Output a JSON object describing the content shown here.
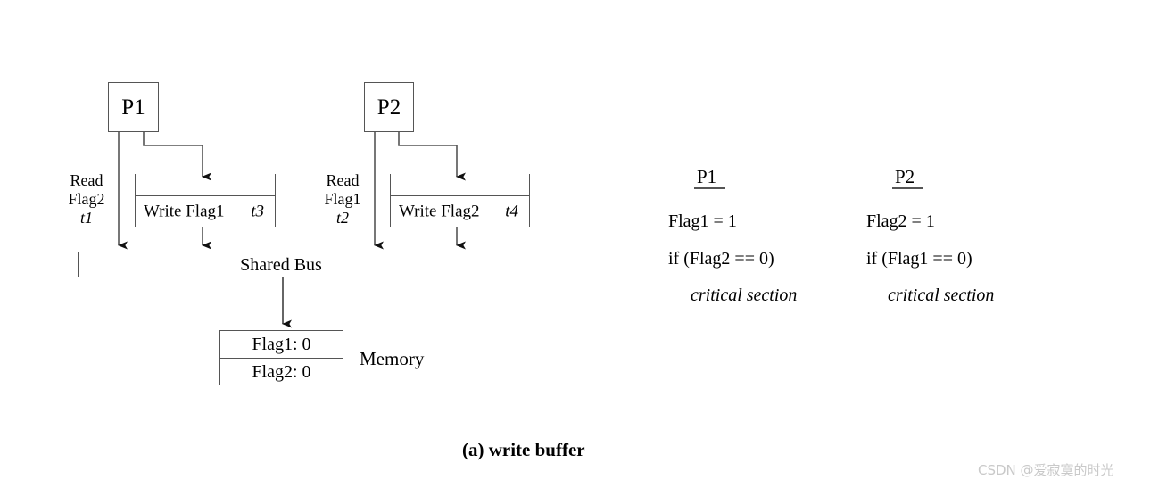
{
  "figure": {
    "caption": "(a) write buffer",
    "memory_label": "Memory",
    "bus_label": "Shared Bus"
  },
  "processors": [
    {
      "name": "P1",
      "read_line1": "Read",
      "read_line2": "Flag2",
      "read_time": "t1",
      "buffer_label": "Write Flag1",
      "buffer_time": "t3"
    },
    {
      "name": "P2",
      "read_line1": "Read",
      "read_line2": "Flag1",
      "read_time": "t2",
      "buffer_label": "Write Flag2",
      "buffer_time": "t4"
    }
  ],
  "memory": {
    "rows": [
      {
        "text": "Flag1: 0"
      },
      {
        "text": "Flag2: 0"
      }
    ]
  },
  "code_columns": [
    {
      "header": "P1",
      "lines": [
        {
          "text": "Flag1 = 1",
          "italic": false
        },
        {
          "text": "if (Flag2 == 0)",
          "italic": false
        },
        {
          "text": "critical section",
          "italic": true
        }
      ]
    },
    {
      "header": "P2",
      "lines": [
        {
          "text": "Flag2 = 1",
          "italic": false
        },
        {
          "text": "if (Flag1 == 0)",
          "italic": false
        },
        {
          "text": "critical section",
          "italic": true
        }
      ]
    }
  ],
  "watermark": {
    "text": "CSDN @爱寂寞的时光"
  },
  "colors": {
    "stroke": "#555555",
    "text": "#000000",
    "background": "#ffffff",
    "watermark": "#c9c9c9"
  }
}
